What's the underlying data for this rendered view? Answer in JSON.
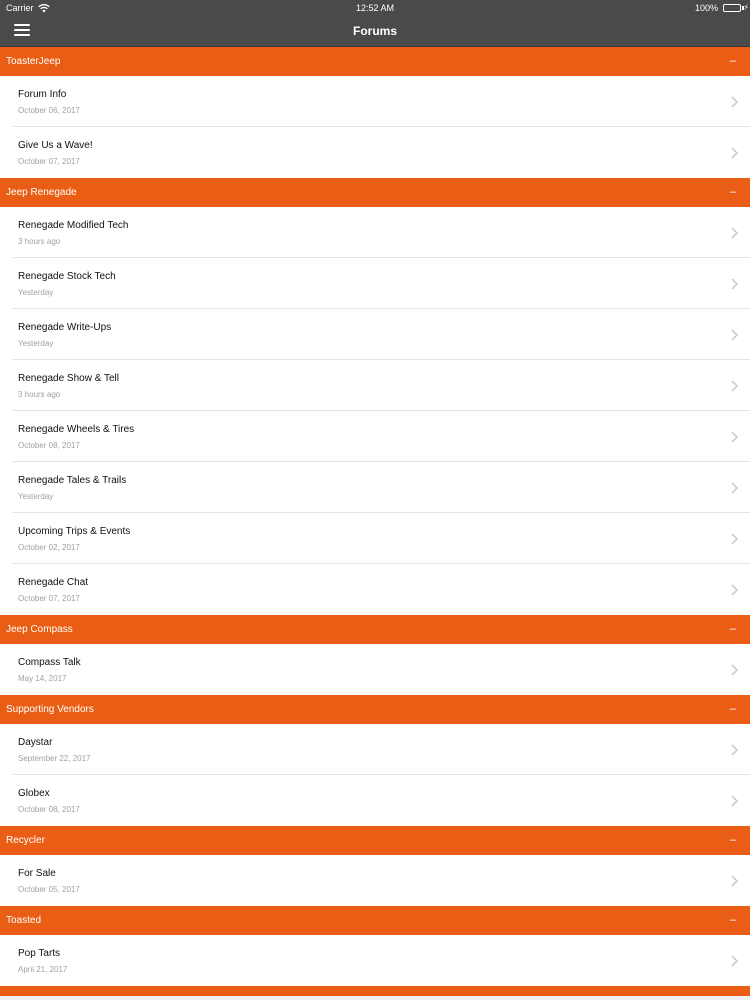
{
  "status_bar": {
    "carrier": "Carrier",
    "time": "12:52 AM",
    "battery": "100%",
    "battery_color": "#4cd964"
  },
  "nav": {
    "title": "Forums",
    "menu_icon": "hamburger-menu-icon"
  },
  "colors": {
    "section_header": "#e95e14",
    "bar": "#4a4a4c"
  },
  "sections": [
    {
      "title": "ToasterJeep",
      "collapse": "–",
      "forums": [
        {
          "name": "Forum Info",
          "date": "October 06, 2017"
        },
        {
          "name": "Give Us a Wave!",
          "date": "October 07, 2017"
        }
      ]
    },
    {
      "title": "Jeep Renegade",
      "collapse": "–",
      "forums": [
        {
          "name": "Renegade Modified Tech",
          "date": "3 hours ago"
        },
        {
          "name": "Renegade Stock Tech",
          "date": "Yesterday"
        },
        {
          "name": "Renegade Write-Ups",
          "date": "Yesterday"
        },
        {
          "name": "Renegade Show & Tell",
          "date": "3 hours ago"
        },
        {
          "name": "Renegade Wheels & Tires",
          "date": "October 08, 2017"
        },
        {
          "name": "Renegade Tales & Trails",
          "date": "Yesterday"
        },
        {
          "name": "Upcoming Trips & Events",
          "date": "October 02, 2017"
        },
        {
          "name": "Renegade Chat",
          "date": "October 07, 2017"
        }
      ]
    },
    {
      "title": "Jeep Compass",
      "collapse": "–",
      "forums": [
        {
          "name": "Compass Talk",
          "date": "May 14, 2017"
        }
      ]
    },
    {
      "title": "Supporting Vendors",
      "collapse": "–",
      "forums": [
        {
          "name": "Daystar",
          "date": "September 22, 2017"
        },
        {
          "name": "Globex",
          "date": "October 08, 2017"
        }
      ]
    },
    {
      "title": "Recycler",
      "collapse": "–",
      "forums": [
        {
          "name": "For Sale",
          "date": "October 05, 2017"
        }
      ]
    },
    {
      "title": "Toasted",
      "collapse": "–",
      "forums": [
        {
          "name": "Pop Tarts",
          "date": "April 21, 2017"
        }
      ]
    }
  ]
}
